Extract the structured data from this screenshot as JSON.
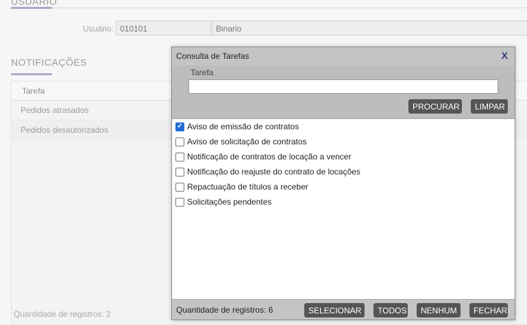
{
  "background": {
    "section_title": "USUÁRIO",
    "user_label": "Usuário:",
    "user_code": "010101",
    "user_name": "Binario",
    "notifications_title": "NOTIFICAÇÕES",
    "grid_header": "Tarefa",
    "rows": [
      "Pedidos atrasados",
      "Pedidos desautorizados"
    ],
    "footer": "Quantidade de registros: 2"
  },
  "modal": {
    "title": "Consulta de Tarefas",
    "close_label": "X",
    "search_label": "Tarefa",
    "search_value": "",
    "procurar_label": "PROCURAR",
    "limpar_label": "LIMPAR",
    "tasks": [
      {
        "label": "Aviso de emissão de contratos",
        "checked": true
      },
      {
        "label": "Aviso de solicitação de contratos",
        "checked": false
      },
      {
        "label": "Notificação de contratos de locação a vencer",
        "checked": false
      },
      {
        "label": "Notificação do reajuste do contrato de locações",
        "checked": false
      },
      {
        "label": "Repactuação de títulos a receber",
        "checked": false
      },
      {
        "label": "Solicitações pendentes",
        "checked": false
      }
    ],
    "footer_count": "Quantidade de registros: 6",
    "selecionar_label": "SELECIONAR",
    "todos_label": "TODOS",
    "nenhum_label": "NENHUM",
    "fechar_label": "FECHAR"
  },
  "colors": {
    "accent_underline": "#b0a8c8",
    "button": "#555555",
    "checkbox_checked": "#1f6fd6",
    "close_x": "#2b3d78"
  }
}
